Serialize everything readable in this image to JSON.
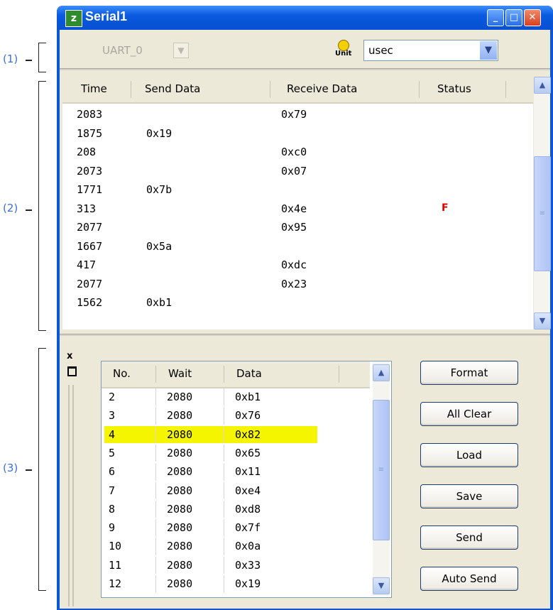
{
  "callouts": {
    "c1": "(1)",
    "c2": "(2)",
    "c3": "(3)"
  },
  "window": {
    "title": "Serial1"
  },
  "toolbar": {
    "channel": "UART_0",
    "unit_label": "Unit",
    "unit_value": "usec"
  },
  "log": {
    "headers": [
      "Time",
      "Send Data",
      "Receive Data",
      "Status"
    ],
    "rows": [
      {
        "time": "2083",
        "send": "",
        "receive": "0x79",
        "status": ""
      },
      {
        "time": "1875",
        "send": "0x19",
        "receive": "",
        "status": ""
      },
      {
        "time": "208",
        "send": "",
        "receive": "0xc0",
        "status": ""
      },
      {
        "time": "2073",
        "send": "",
        "receive": "0x07",
        "status": ""
      },
      {
        "time": "1771",
        "send": "0x7b",
        "receive": "",
        "status": ""
      },
      {
        "time": "313",
        "send": "",
        "receive": "0x4e",
        "status": "F"
      },
      {
        "time": "2077",
        "send": "",
        "receive": "0x95",
        "status": ""
      },
      {
        "time": "1667",
        "send": "0x5a",
        "receive": "",
        "status": ""
      },
      {
        "time": "417",
        "send": "",
        "receive": "0xdc",
        "status": ""
      },
      {
        "time": "2077",
        "send": "",
        "receive": "0x23",
        "status": ""
      },
      {
        "time": "1562",
        "send": "0xb1",
        "receive": "",
        "status": ""
      }
    ]
  },
  "sendlist": {
    "headers": [
      "No.",
      "Wait",
      "Data"
    ],
    "rows": [
      {
        "no": "2",
        "wait": "2080",
        "data": "0xb1"
      },
      {
        "no": "3",
        "wait": "2080",
        "data": "0x76"
      },
      {
        "no": "4",
        "wait": "2080",
        "data": "0x82"
      },
      {
        "no": "5",
        "wait": "2080",
        "data": "0x65"
      },
      {
        "no": "6",
        "wait": "2080",
        "data": "0x11"
      },
      {
        "no": "7",
        "wait": "2080",
        "data": "0xe4"
      },
      {
        "no": "8",
        "wait": "2080",
        "data": "0xd8"
      },
      {
        "no": "9",
        "wait": "2080",
        "data": "0x7f"
      },
      {
        "no": "10",
        "wait": "2080",
        "data": "0x0a"
      },
      {
        "no": "11",
        "wait": "2080",
        "data": "0x33"
      },
      {
        "no": "12",
        "wait": "2080",
        "data": "0x19"
      }
    ],
    "selected_no": "4"
  },
  "buttons": {
    "format": "Format",
    "all_clear": "All Clear",
    "load": "Load",
    "save": "Save",
    "send": "Send",
    "auto_send": "Auto Send"
  },
  "icons": {
    "app": "serial-window-icon",
    "unit": "clock-unit-icon",
    "minimize": "minimize-icon",
    "maximize": "maximize-icon",
    "close": "close-icon"
  },
  "colors": {
    "title_bar": "#0a58d8",
    "selected_row": "#f5f500",
    "status_error": "#e00000",
    "callout": "#3a6fd8"
  }
}
